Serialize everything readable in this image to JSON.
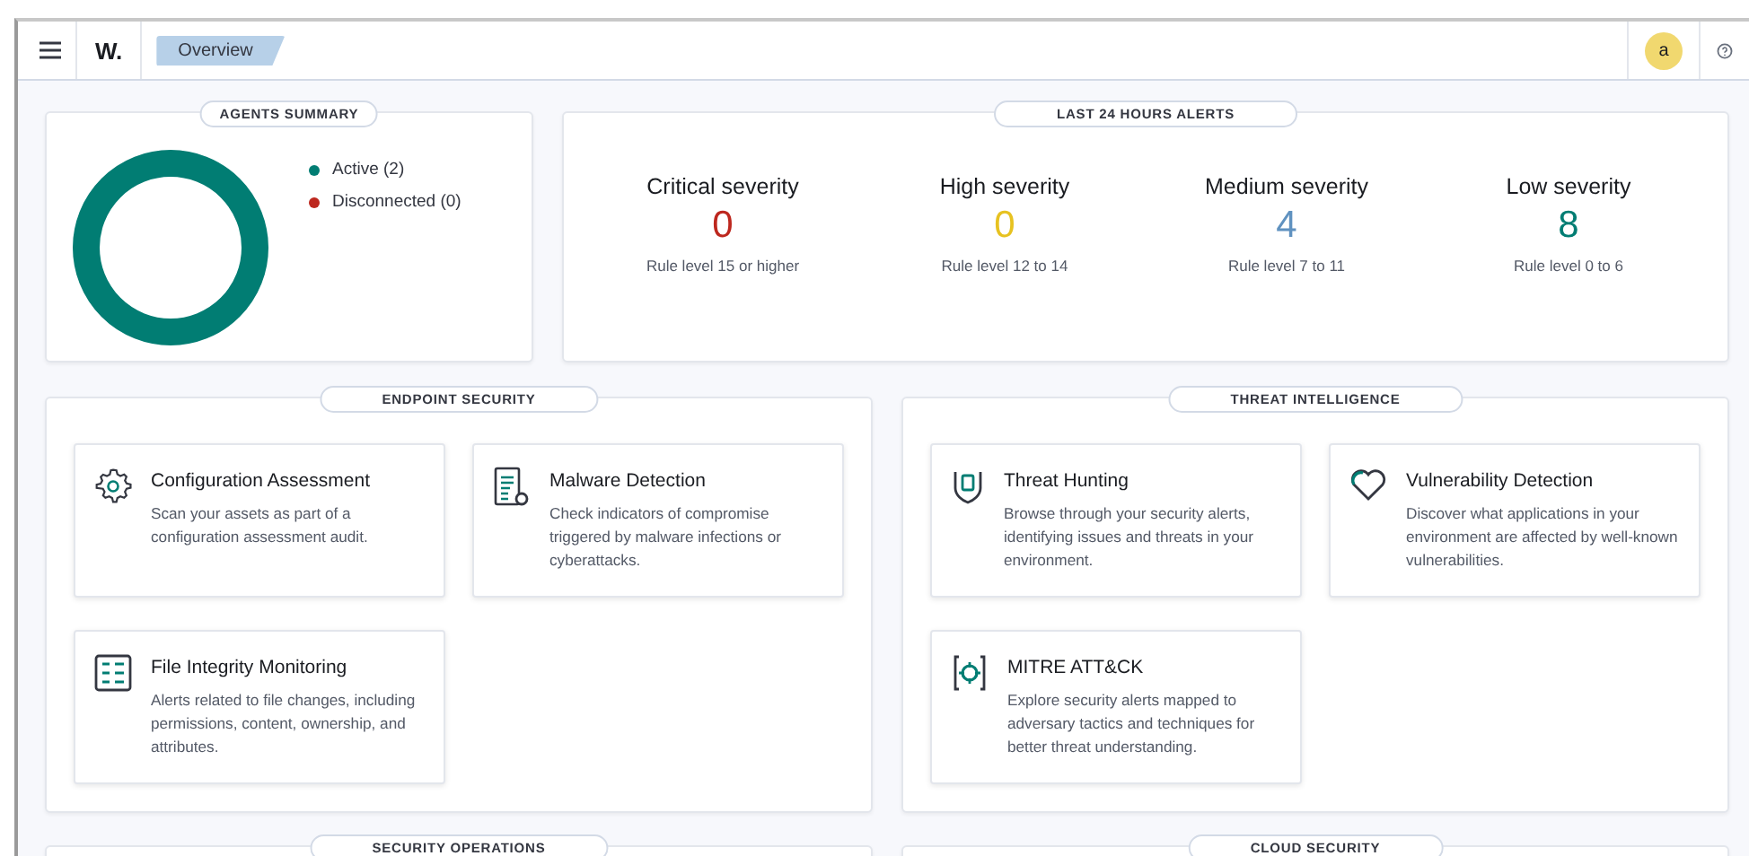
{
  "topbar": {
    "logo": "W.",
    "breadcrumb": "Overview",
    "avatar": "a"
  },
  "agents_summary": {
    "title": "AGENTS SUMMARY",
    "legend": [
      {
        "label": "Active (2)",
        "color": "#017d73"
      },
      {
        "label": "Disconnected (0)",
        "color": "#bd271e"
      }
    ]
  },
  "alerts": {
    "title": "LAST 24 HOURS ALERTS",
    "items": [
      {
        "label": "Critical severity",
        "count": "0",
        "rule": "Rule level 15 or higher",
        "color": "#bd271e"
      },
      {
        "label": "High severity",
        "count": "0",
        "rule": "Rule level 12 to 14",
        "color": "#e7c221"
      },
      {
        "label": "Medium severity",
        "count": "4",
        "rule": "Rule level 7 to 11",
        "color": "#6092c0"
      },
      {
        "label": "Low severity",
        "count": "8",
        "rule": "Rule level 0 to 6",
        "color": "#017d73"
      }
    ]
  },
  "panels": [
    {
      "title": "ENDPOINT SECURITY",
      "cards": [
        {
          "title": "Configuration Assessment",
          "text": "Scan your assets as part of a configuration assessment audit."
        },
        {
          "title": "Malware Detection",
          "text": "Check indicators of compromise triggered by malware infections or cyberattacks."
        },
        {
          "title": "File Integrity Monitoring",
          "text": "Alerts related to file changes, including permissions, content, ownership, and attributes."
        }
      ]
    },
    {
      "title": "THREAT INTELLIGENCE",
      "cards": [
        {
          "title": "Threat Hunting",
          "text": "Browse through your security alerts, identifying issues and threats in your environment."
        },
        {
          "title": "Vulnerability Detection",
          "text": "Discover what applications in your environment are affected by well-known vulnerabilities."
        },
        {
          "title": "MITRE ATT&CK",
          "text": "Explore security alerts mapped to adversary tactics and techniques for better threat understanding."
        }
      ]
    },
    {
      "title": "SECURITY OPERATIONS"
    },
    {
      "title": "CLOUD SECURITY"
    }
  ]
}
